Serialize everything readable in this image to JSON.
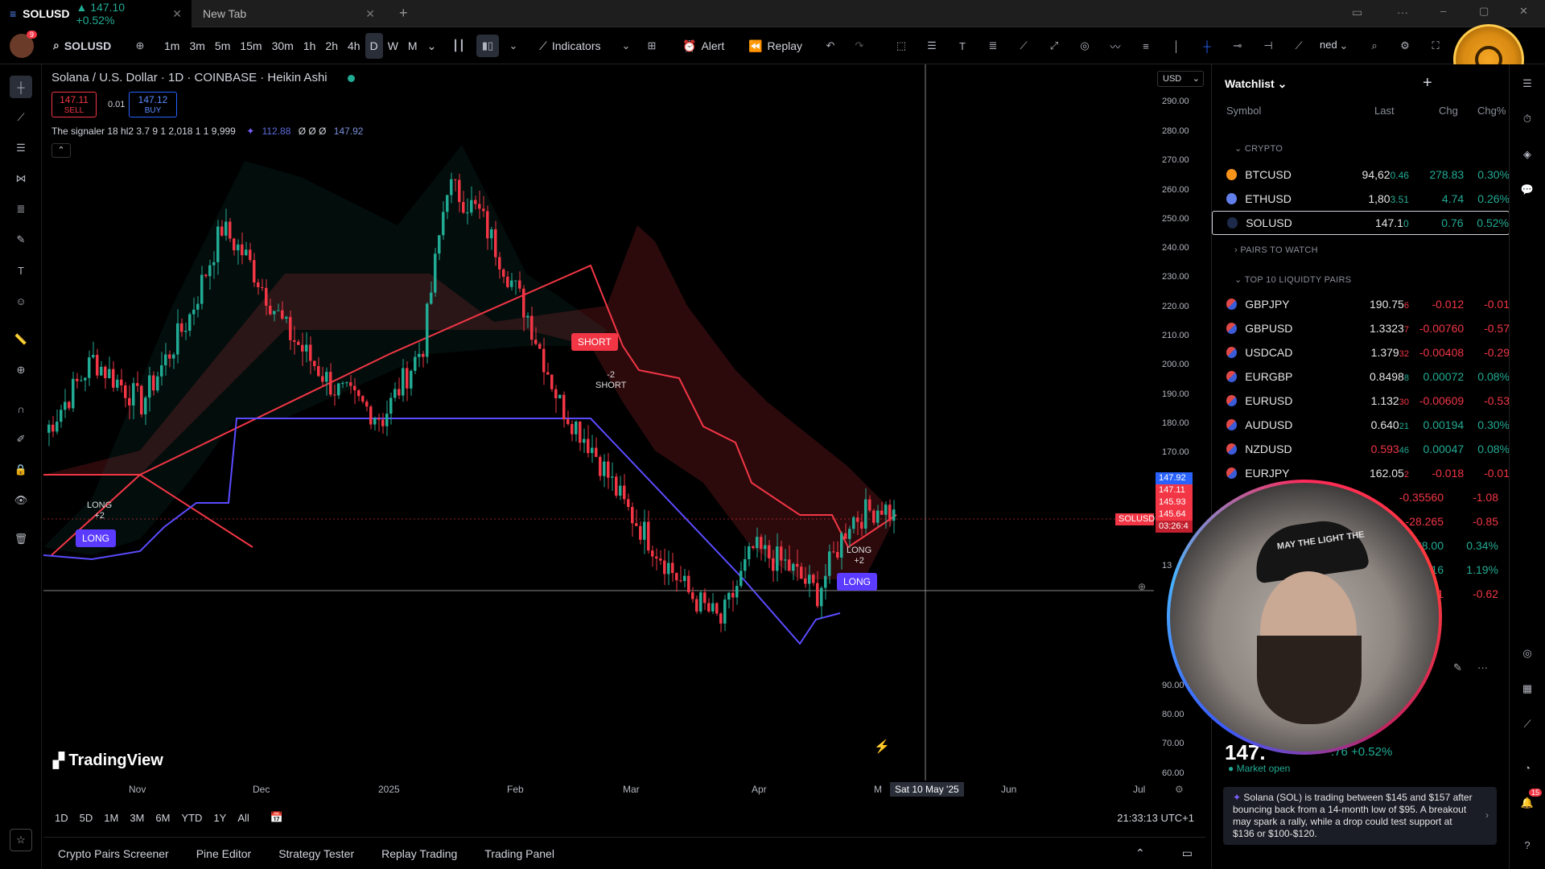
{
  "tabs": [
    {
      "label": "SOLUSD",
      "price": "147.10",
      "change": "+0.52%"
    },
    {
      "label": "New Tab"
    }
  ],
  "toolbar": {
    "symbol": "SOLUSD",
    "intervals": [
      "1m",
      "3m",
      "5m",
      "15m",
      "30m",
      "1h",
      "2h",
      "4h",
      "D",
      "W",
      "M"
    ],
    "indicators": "Indicators",
    "alert": "Alert",
    "replay": "Replay",
    "misc": "ned",
    "avatar_badge": "9"
  },
  "chart": {
    "title": "Solana / U.S. Dollar · 1D · COINBASE · Heikin Ashi",
    "sell_price": "147.11",
    "sell_label": "SELL",
    "spread": "0.01",
    "buy_price": "147.12",
    "buy_label": "BUY",
    "indicator": "The signaler 18 hl2 3.7 9 1 2,018 1 1 9,999",
    "ind_v1": "112.88",
    "ind_v2": "Ø Ø Ø",
    "ind_v3": "147.92",
    "currency": "USD",
    "y_ticks": [
      "290.00",
      "280.00",
      "270.00",
      "260.00",
      "250.00",
      "240.00",
      "230.00",
      "220.00",
      "210.00",
      "200.00",
      "190.00",
      "180.00",
      "170.00",
      "13",
      "90.00",
      "80.00",
      "70.00",
      "60.00"
    ],
    "x_ticks": [
      "Nov",
      "Dec",
      "2025",
      "Feb",
      "Mar",
      "Apr",
      "M",
      "Jun",
      "Jul"
    ],
    "crosshair_date": "Sat 10 May '25",
    "price_labels": [
      "147.92",
      "147.11",
      "145.93",
      "145.64",
      "03:26:4"
    ],
    "sol_tag": "SOLUSD",
    "signals": {
      "short": "SHORT",
      "short_small": "SHORT",
      "short_count": "-2",
      "long1": "LONG",
      "long1_small": "LONG",
      "long1_count": "+2",
      "long2": "LONG",
      "long2_small": "LONG",
      "long2_count": "+2"
    },
    "logo": "TradingView",
    "ranges": [
      "1D",
      "5D",
      "1M",
      "3M",
      "6M",
      "YTD",
      "1Y",
      "All"
    ],
    "clock": "21:33:13 UTC+1"
  },
  "chart_data": {
    "type": "candlestick",
    "x_axis": [
      "Nov",
      "Dec",
      "2025",
      "Feb",
      "Mar",
      "Apr",
      "May",
      "Jun",
      "Jul"
    ],
    "ylim": [
      55,
      295
    ],
    "last_price": 147.11
  },
  "bottom_tabs": [
    "Crypto Pairs Screener",
    "Pine Editor",
    "Strategy Tester",
    "Replay Trading",
    "Trading Panel"
  ],
  "watchlist": {
    "title": "Watchlist",
    "cols": [
      "Symbol",
      "Last",
      "Chg",
      "Chg%"
    ],
    "sections": [
      "CRYPTO",
      "PAIRS TO WATCH",
      "TOP 10 LIQUIDTY PAIRS"
    ],
    "crypto": [
      {
        "sym": "BTCUSD",
        "last": "94,62",
        "last_small": "0.46",
        "chg": "278.83",
        "chgp": "0.30%",
        "color": "#f7931a"
      },
      {
        "sym": "ETHUSD",
        "last": "1,80",
        "last_small": "3.51",
        "chg": "4.74",
        "chgp": "0.26%",
        "color": "#627eea"
      },
      {
        "sym": "SOLUSD",
        "last": "147.1",
        "last_small": "0",
        "chg": "0.76",
        "chgp": "0.52%",
        "color": "#1e2a4a"
      }
    ],
    "pairs": [
      {
        "sym": "GBPJPY",
        "last": "190.75",
        "last_small": "6",
        "chg": "-0.012",
        "chgp": "-0.01"
      },
      {
        "sym": "GBPUSD",
        "last": "1.3323",
        "last_small": "7",
        "chg": "-0.00760",
        "chgp": "-0.57"
      },
      {
        "sym": "USDCAD",
        "last": "1.379",
        "last_small": "32",
        "chg": "-0.00408",
        "chgp": "-0.29"
      },
      {
        "sym": "EURGBP",
        "last": "0.8498",
        "last_small": "8",
        "chg": "0.00072",
        "chgp": "0.08%"
      },
      {
        "sym": "EURUSD",
        "last": "1.132",
        "last_small": "30",
        "chg": "-0.00609",
        "chgp": "-0.53"
      },
      {
        "sym": "AUDUSD",
        "last": "0.640",
        "last_small": "21",
        "chg": "0.00194",
        "chgp": "0.30%"
      },
      {
        "sym": "NZDUSD",
        "last": "0.593",
        "last_small": "46",
        "chg": "0.00047",
        "chgp": "0.08%"
      },
      {
        "sym": "EURJPY",
        "last": "162.05",
        "last_small": "2",
        "chg": "-0.018",
        "chgp": "-0.01"
      }
    ],
    "partial": [
      {
        "chg": "-0.35560",
        "chgp": "-1.08"
      },
      {
        "chg": "-28.265",
        "chgp": "-0.85"
      },
      {
        "chg": "38.00",
        "chgp": "0.34%"
      },
      {
        "chg": "16",
        "chgp": "1.19%"
      },
      {
        "chg": "41",
        "chgp": "-0.62"
      }
    ],
    "big_price": "147.",
    "big_chg": ".76",
    "big_chgp": "+0.52%",
    "market_status": "Market open",
    "news": "Solana (SOL) is trading between $145 and $157 after bouncing back from a 14-month low of $95. A breakout may spark a rally, while a drop could test support at $136 or $100-$120.",
    "notif_badge": "15"
  },
  "cap_text": "MAY THE LIGHT THE"
}
